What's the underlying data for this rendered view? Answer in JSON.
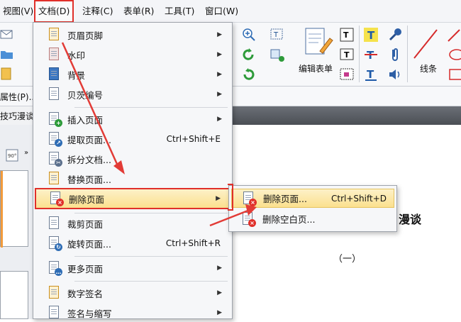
{
  "menubar": {
    "items": [
      "视图(V)",
      "文档(D)",
      "注释(C)",
      "表单(R)",
      "工具(T)",
      "窗口(W)"
    ]
  },
  "ribbon": {
    "form_edit_label": "编辑表单",
    "line_label": "线条",
    "properties_label": "属性(P)...",
    "tab_label": "技巧漫谈"
  },
  "menu": {
    "items": [
      {
        "label": "页眉页脚",
        "shortcut": "",
        "arrow": "▶"
      },
      {
        "label": "水印",
        "shortcut": "",
        "arrow": "▶"
      },
      {
        "label": "背景",
        "shortcut": "",
        "arrow": "▶"
      },
      {
        "label": "贝茨编号",
        "shortcut": "",
        "arrow": "▶"
      },
      {
        "label": "插入页面",
        "shortcut": "",
        "arrow": "▶"
      },
      {
        "label": "提取页面...",
        "shortcut": "Ctrl+Shift+E",
        "arrow": ""
      },
      {
        "label": "拆分文档...",
        "shortcut": "",
        "arrow": ""
      },
      {
        "label": "替换页面...",
        "shortcut": "",
        "arrow": ""
      },
      {
        "label": "删除页面",
        "shortcut": "",
        "arrow": "▶"
      },
      {
        "label": "裁剪页面",
        "shortcut": "",
        "arrow": ""
      },
      {
        "label": "旋转页面...",
        "shortcut": "Ctrl+Shift+R",
        "arrow": ""
      },
      {
        "label": "更多页面",
        "shortcut": "",
        "arrow": "▶"
      },
      {
        "label": "数字签名",
        "shortcut": "",
        "arrow": "▶"
      },
      {
        "label": "签名与缩写",
        "shortcut": "",
        "arrow": "▶"
      }
    ]
  },
  "submenu": {
    "items": [
      {
        "label": "删除页面...",
        "shortcut": "Ctrl+Shift+D"
      },
      {
        "label": "删除空白页..."
      }
    ]
  },
  "document": {
    "title_fragment": "漫谈",
    "subtitle": "（一）"
  },
  "colors": {
    "highlight_border": "#e0302a",
    "menu_highlight": "#fbe08e",
    "arrow": "#e23b36"
  }
}
